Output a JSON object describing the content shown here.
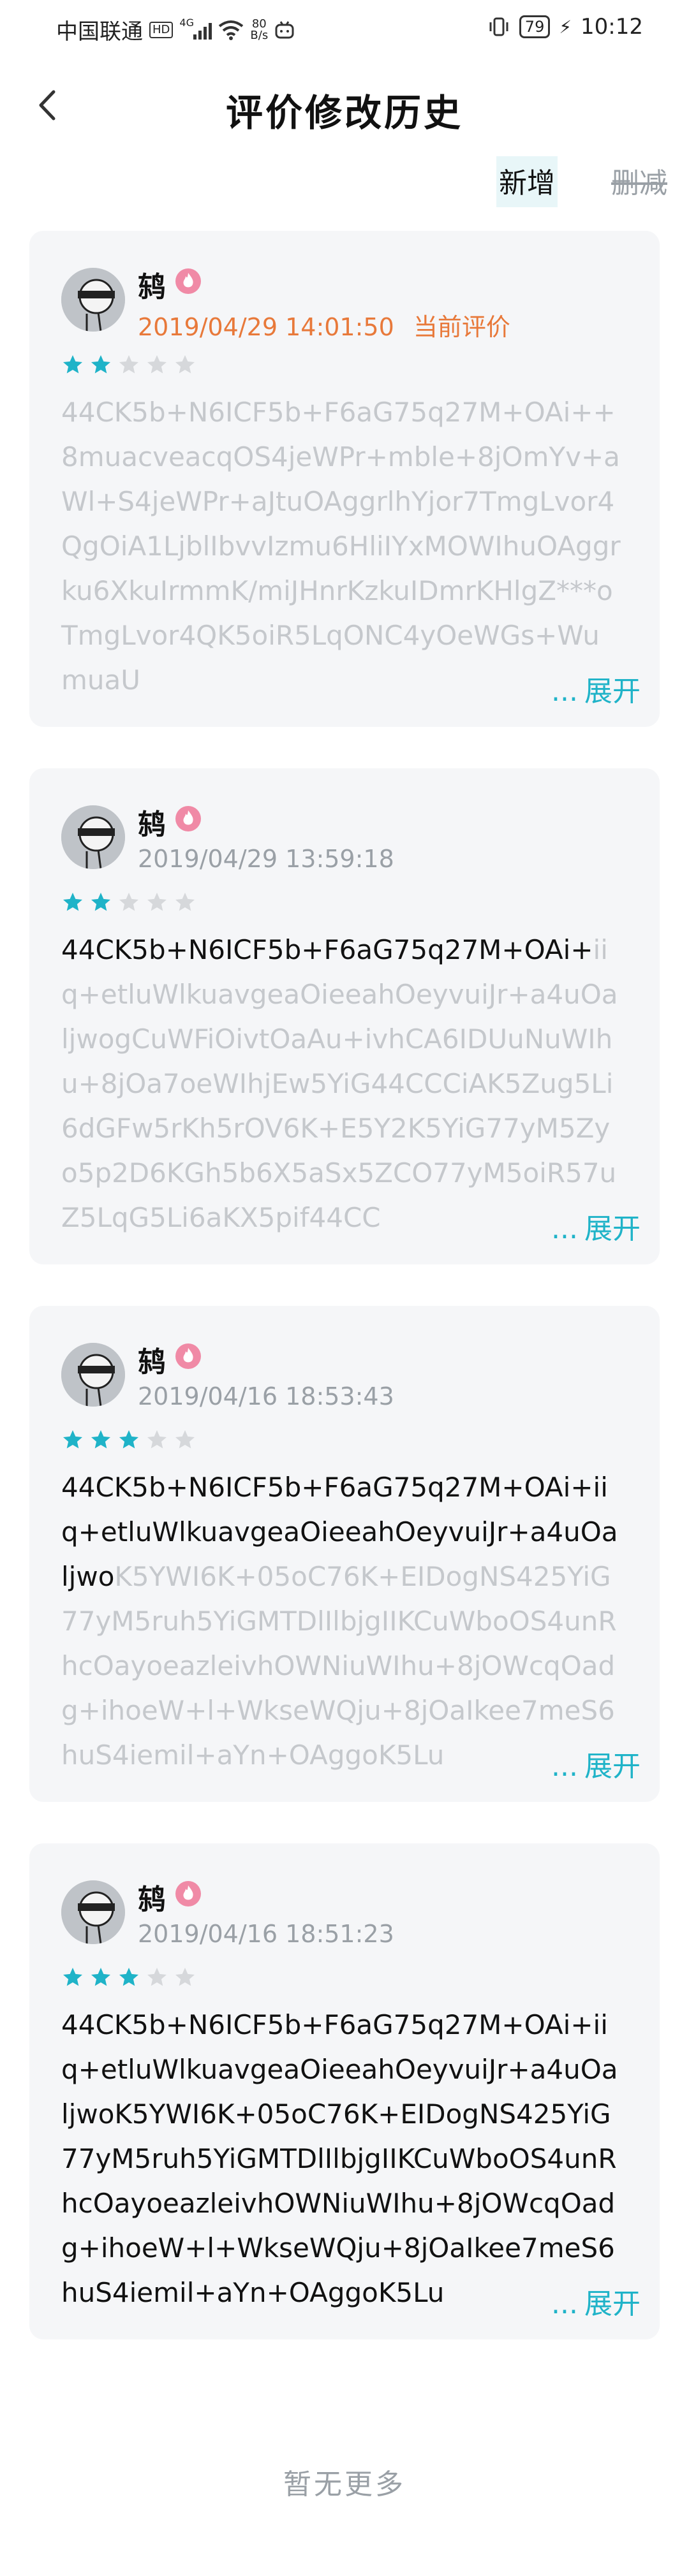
{
  "status_bar": {
    "carrier": "中国联通",
    "network_badge": "HD",
    "signal_label": "4G",
    "net_speed_value": "80",
    "net_speed_unit": "B/s",
    "battery": "79",
    "time": "10:12"
  },
  "header": {
    "title": "评价修改历史"
  },
  "tabs": [
    {
      "label": "新增",
      "active": true
    },
    {
      "label": "删减",
      "active": false
    }
  ],
  "entries": [
    {
      "username": "鸫",
      "datetime": "2019/04/29 14:01:50",
      "current_label": "当前评价",
      "rating": 2,
      "max_rating": 5,
      "content_highlight": "",
      "content_faded": "44CK5b+N6ICF5b+F6aG75q27M+OAi++8muacveacqOS4jeWPr+mble+8jOmYv+aWl+S4jeWPr+aJtuOAggrlhYjor7TmgLvor4QgOiA1LjblIbvvIzmu6HliIYxMOWIhuOAggrku6XkuIrmmK/miJHnrKzkuIDmrKHlgZ***oTmgLvor4QK5oiR5LqONC4yOeWGs+WumuaU",
      "expand_ellipsis": "...",
      "expand_label": "展开"
    },
    {
      "username": "鸫",
      "datetime": "2019/04/29 13:59:18",
      "current_label": "",
      "rating": 2,
      "max_rating": 5,
      "content_highlight": "44CK5b+N6ICF5b+F6aG75q27M+OAi+",
      "content_faded": "iiq+etluWlkuavgeaOieeahOeyvuiJr+a4uOaljwogCuWFiOivtOaAu+ivhCA6IDUuNuWIhu+8jOa7oeWIhjEw5YiG44CCCiAK5Zug5Li6dGFw5rKh5rOV6K+E5Y2K5YiG77yM5Zyo5p2D6KGh5b6X5aSx5ZCO77yM5oiR57uZ5LqG5Li6aKX5pif44CC",
      "expand_ellipsis": "...",
      "expand_label": "展开"
    },
    {
      "username": "鸫",
      "datetime": "2019/04/16 18:53:43",
      "current_label": "",
      "rating": 3,
      "max_rating": 5,
      "content_highlight": "44CK5b+N6ICF5b+F6aG75q27M+OAi+iiq+etluWlkuavgeaOieeahOeyvuiJr+a4uOaljwo",
      "content_faded": "K5YWI6K+05oC76K+EIDogNS425YiG77yM5ruh5YiGMTDlIlbjgIIKCuWboOS4unRhcOayoeazleivhOWNiuWIhu+8jOWcqOadg+ihoeW+l+WkseWQju+8jOaIkee7meS6huS4iemil+aYn+OAggoK5Lu",
      "expand_ellipsis": "...",
      "expand_label": "展开"
    },
    {
      "username": "鸫",
      "datetime": "2019/04/16 18:51:23",
      "current_label": "",
      "rating": 3,
      "max_rating": 5,
      "content_highlight": "44CK5b+N6ICF5b+F6aG75q27M+OAi+iiq+etluWlkuavgeaOieeahOeyvuiJr+a4uOaljwoK5YWI6K+05oC76K+EIDogNS425YiG77yM5ruh5YiGMTDlIlbjgIIKCuWboOS4unRhcOayoeazleivhOWNiuWIhu+8jOWcqOadg+ihoeW+l+WkseWQju+8jOaIkee7meS6huS4iemil+aYn+OAggoK5Lu",
      "content_faded": "",
      "expand_ellipsis": "...",
      "expand_label": "展开"
    }
  ],
  "footer": {
    "text": "暂无更多"
  },
  "colors": {
    "accent": "#1fb3c8",
    "current_date": "#e8793a",
    "card_bg": "#f5f6f8",
    "faded_text": "#c5c8cc",
    "star_on": "#1fb3c8",
    "star_off": "#d6d8db"
  },
  "icons": {
    "back": "chevron-left-icon",
    "level_badge": "flame-badge-icon",
    "star": "star-icon"
  }
}
